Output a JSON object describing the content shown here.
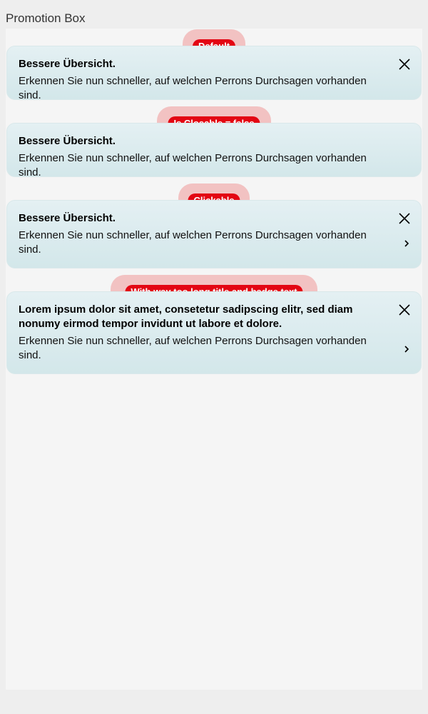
{
  "page": {
    "title": "Promotion Box"
  },
  "boxes": [
    {
      "badge": "Default",
      "title": "Bessere Übersicht.",
      "text": "Erkennen Sie nun schneller, auf welchen Perrons Durchsagen vorhanden sind.",
      "closable": true,
      "clickable": false
    },
    {
      "badge": "Is Closable = false",
      "title": "Bessere Übersicht.",
      "text": "Erkennen Sie nun schneller, auf welchen Perrons Durchsagen vorhanden sind.",
      "closable": false,
      "clickable": false
    },
    {
      "badge": "Clickable",
      "title": "Bessere Übersicht.",
      "text": "Erkennen Sie nun schneller, auf welchen Perrons Durchsagen vorhanden sind.",
      "closable": true,
      "clickable": true
    },
    {
      "badge": "With way too long title and badge text",
      "title": "Lorem ipsum dolor sit amet, consetetur sadipscing elitr, sed diam nonumy eirmod tempor invidunt ut labore et dolore.",
      "text": "Erkennen Sie nun schneller, auf welchen Perrons Durchsagen vorhanden sind.",
      "closable": true,
      "clickable": true
    }
  ],
  "icons": {
    "close": "close-icon",
    "chevron": "chevron-right-icon"
  },
  "colors": {
    "badge": "#e30613",
    "badge_halo": "#f2c2c2",
    "card": "#dcecef"
  }
}
